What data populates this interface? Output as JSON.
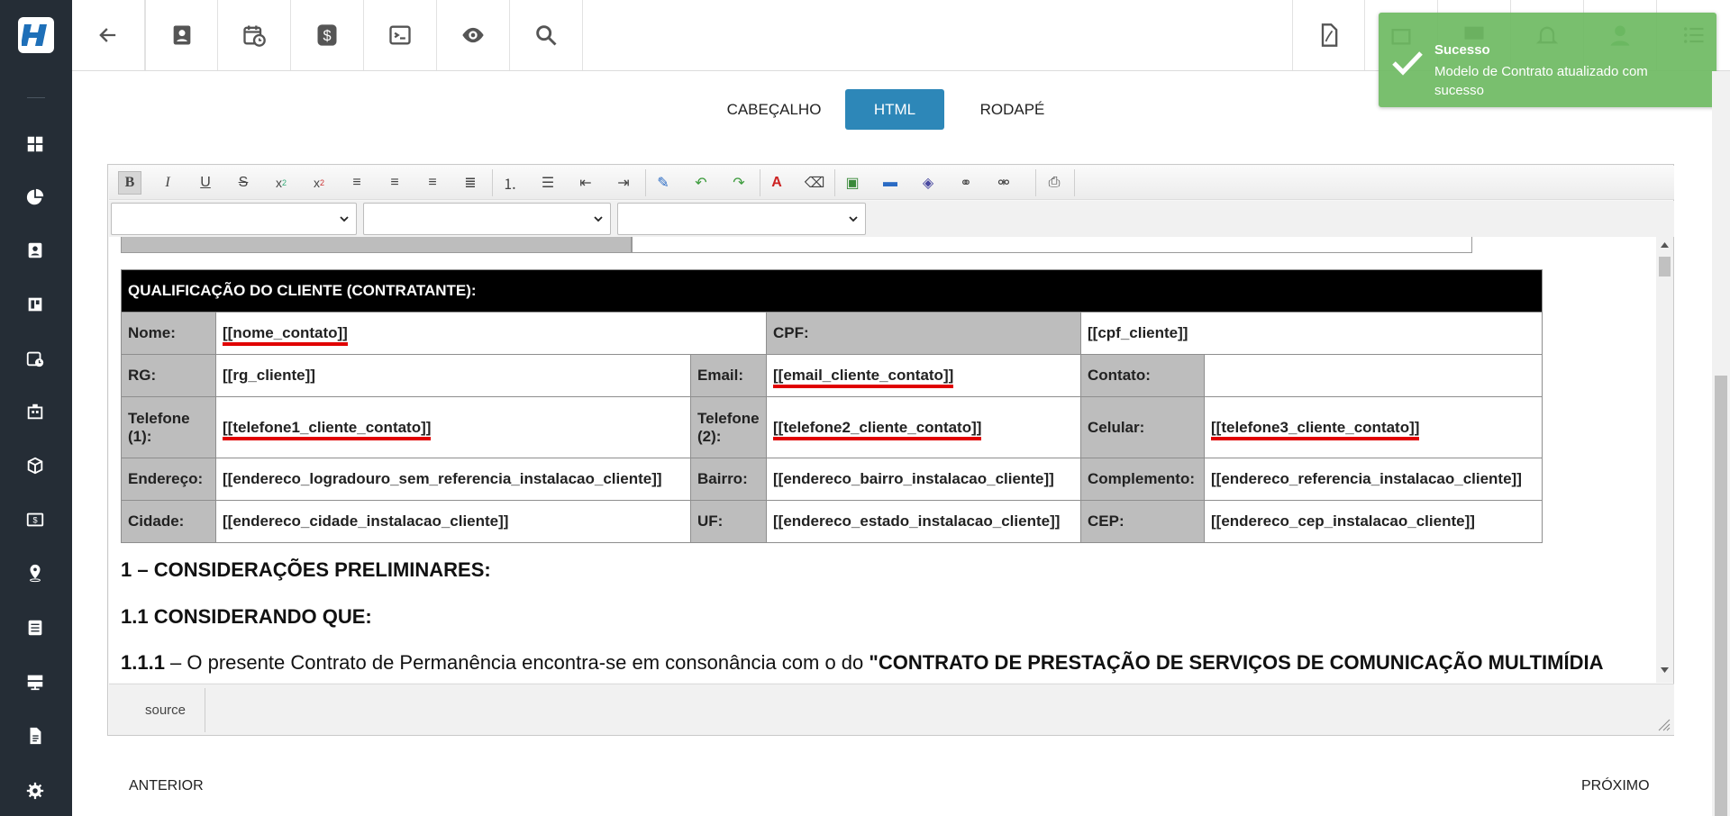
{
  "toolbar_top": {
    "buttons": [
      "back-icon",
      "contact-icon",
      "calendar-clock-icon",
      "dollar-icon",
      "terminal-icon",
      "eye-icon",
      "search-icon"
    ],
    "right_buttons": [
      "pdf-icon",
      "building-icon",
      "monitor-icon",
      "bell-icon",
      "user-avatar-icon",
      "list-icon"
    ]
  },
  "toast": {
    "title": "Sucesso",
    "message": "Modelo de Contrato atualizado com sucesso",
    "color": "#6eba62"
  },
  "tabs": [
    {
      "label": "CABEÇALHO",
      "active": false
    },
    {
      "label": "HTML",
      "active": true
    },
    {
      "label": "RODAPÉ",
      "active": false
    }
  ],
  "editor": {
    "toolbar_icons": [
      "bold-icon",
      "italic-icon",
      "underline-icon",
      "strikethrough-icon",
      "subscript-icon",
      "superscript-icon",
      "align-left-icon",
      "align-center-icon",
      "align-right-icon",
      "align-justify-icon",
      "ordered-list-icon",
      "unordered-list-icon",
      "outdent-icon",
      "indent-icon",
      "remove-format-icon",
      "undo-icon",
      "redo-icon",
      "font-color-icon",
      "highlight-icon",
      "image-icon",
      "horizontal-rule-icon",
      "insert-object-icon",
      "link-icon",
      "unlink-icon",
      "print-icon"
    ],
    "source_label": "source"
  },
  "table": {
    "header": "QUALIFICAÇÃO DO CLIENTE (CONTRATANTE):",
    "r1": {
      "nome_label": "Nome:",
      "nome_val": "[[nome_contato]]",
      "cpf_label": "CPF:",
      "cpf_val": "[[cpf_cliente]]"
    },
    "r2": {
      "rg_label": "RG:",
      "rg_val": "[[rg_cliente]]",
      "email_label": "Email:",
      "email_val": "[[email_cliente_contato]]",
      "contato_label": "Contato:",
      "contato_val": ""
    },
    "r3": {
      "tel1_label": "Telefone (1):",
      "tel1_val": "[[telefone1_cliente_contato]]",
      "tel2_label": "Telefone (2):",
      "tel2_val": "[[telefone2_cliente_contato]]",
      "cel_label": "Celular:",
      "cel_val": "[[telefone3_cliente_contato]]"
    },
    "r4": {
      "end_label": "Endereço:",
      "end_val": "[[endereco_logradouro_sem_referencia_instalacao_cliente]]",
      "bairro_label": "Bairro:",
      "bairro_val": "[[endereco_bairro_instalacao_cliente]]",
      "comp_label": "Complemento:",
      "comp_val": "[[endereco_referencia_instalacao_cliente]]"
    },
    "r5": {
      "cid_label": "Cidade:",
      "cid_val": "[[endereco_cidade_instalacao_cliente]]",
      "uf_label": "UF:",
      "uf_val": "[[endereco_estado_instalacao_cliente]]",
      "cep_label": "CEP:",
      "cep_val": "[[endereco_cep_instalacao_cliente]]"
    }
  },
  "doc": {
    "h1": "1 – CONSIDERAÇÕES PRELIMINARES:",
    "h2": "1.1 CONSIDERANDO QUE:",
    "p_num": "1.1.1",
    "p_text": " – O presente Contrato de Permanência encontra-se em consonância com o do ",
    "p_bold": "\"CONTRATO DE PRESTAÇÃO DE SERVIÇOS DE COMUNICAÇÃO MULTIMÍDIA"
  },
  "nav": {
    "prev": "ANTERIOR",
    "next": "PRÓXIMO"
  }
}
